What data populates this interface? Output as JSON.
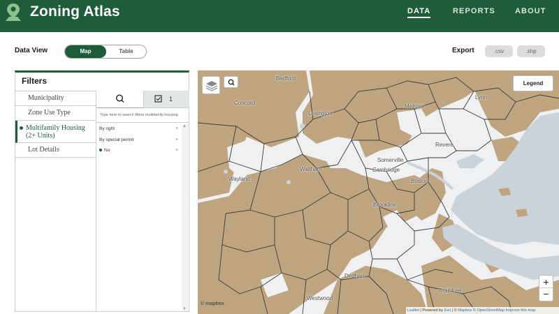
{
  "header": {
    "title": "Zoning Atlas",
    "nav": [
      {
        "label": "DATA",
        "active": true
      },
      {
        "label": "REPORTS",
        "active": false
      },
      {
        "label": "ABOUT",
        "active": false
      }
    ]
  },
  "toolbar": {
    "data_view_label": "Data View",
    "view_options": [
      "Map",
      "Table"
    ],
    "selected_view": "Map",
    "export_label": "Export",
    "export_options": [
      ".csv",
      ".shp"
    ]
  },
  "filters": {
    "title": "Filters",
    "categories": [
      {
        "label": "Municipality"
      },
      {
        "label": "Zone Use Type"
      },
      {
        "label_line1": "Multifamily Housing",
        "label_line2": "(2+ Units)",
        "selected": true
      },
      {
        "label": "Lot Details"
      }
    ],
    "selected_count": "1",
    "search_placeholder": "Type here to search filters multifamily housing",
    "options": [
      {
        "label": "By right",
        "mark": "+"
      },
      {
        "label": "By special permit",
        "mark": "+"
      },
      {
        "label": "No",
        "mark": "×",
        "selected": true
      }
    ]
  },
  "map": {
    "legend_button": "Legend",
    "zoom_in": "+",
    "zoom_out": "−",
    "logo_text": "© mapbox",
    "place_labels": [
      "Bedford",
      "Concord",
      "Lexington",
      "Lynn",
      "Melrose",
      "Revere",
      "Somerville",
      "Cambridge",
      "Boston",
      "Waltham",
      "Wayland",
      "Brookline",
      "Dedham",
      "Braintree",
      "Westwood"
    ],
    "attribution": {
      "leaflet": "Leaflet",
      "powered": " | Powered by ",
      "esri": "Esri",
      "sep": " | © ",
      "mapbox": "Mapbox",
      "osm": " © OpenStreetMap",
      "improve": " Improve this map"
    },
    "colors": {
      "zoned": "#bfa57f",
      "water": "#c9d3d9",
      "background": "#eef0f1",
      "boundary": "#3a3a3a"
    }
  },
  "colors": {
    "brand": "#1e5c3a"
  }
}
